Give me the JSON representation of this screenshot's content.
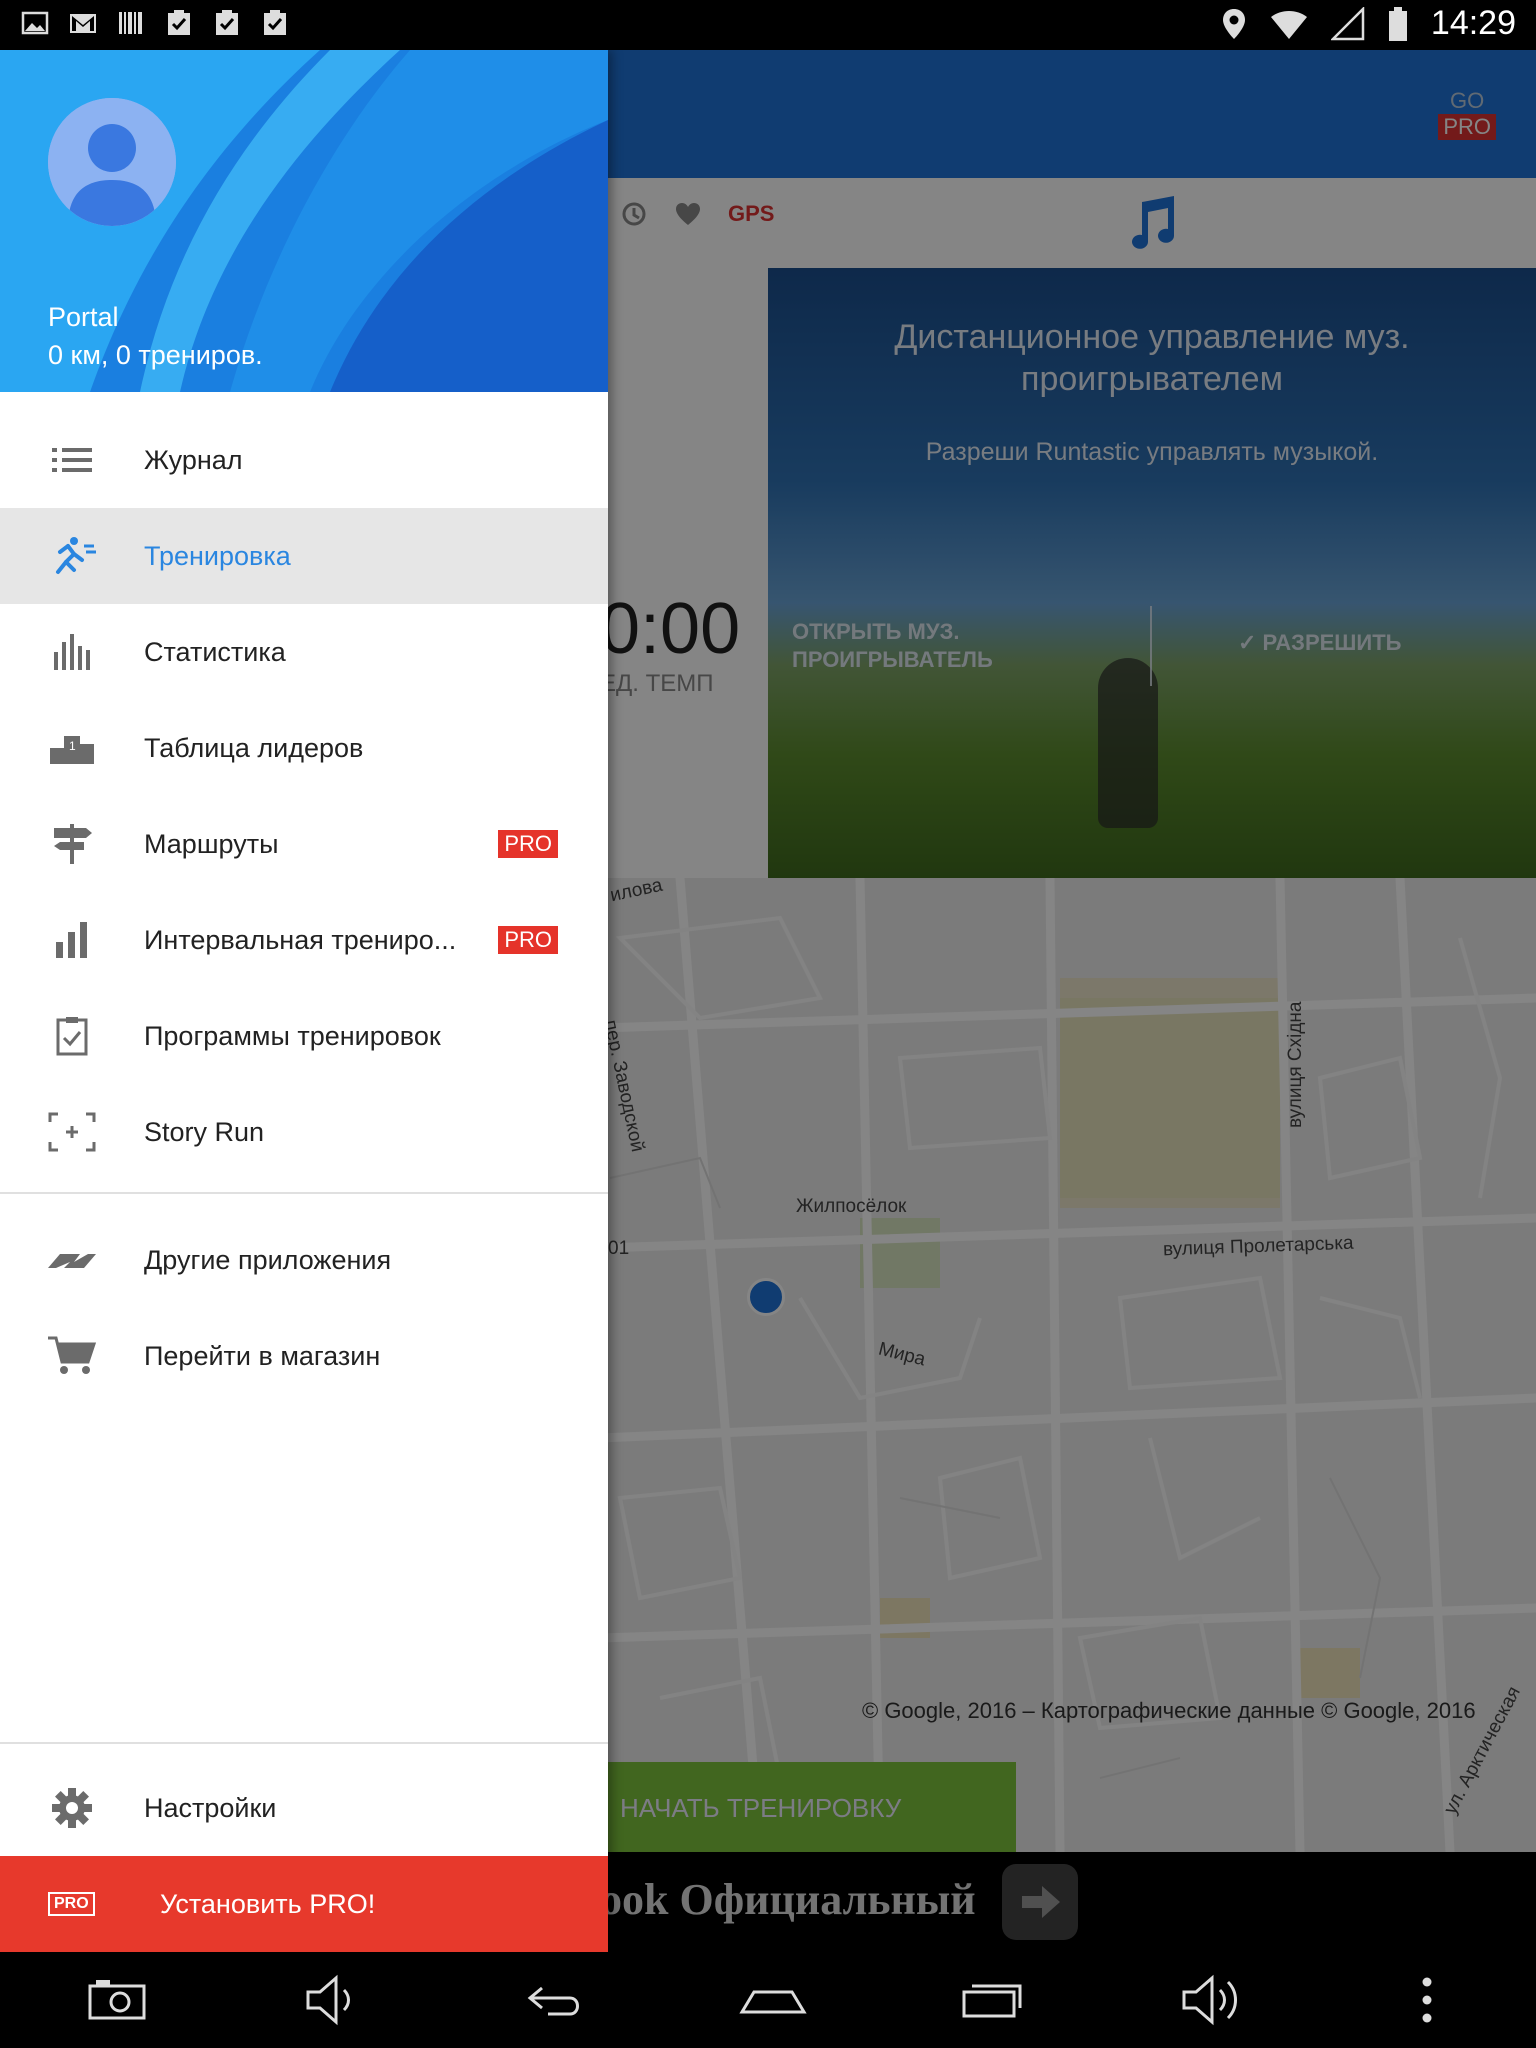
{
  "status_bar": {
    "time": "14:29",
    "notification_icons": [
      "image-icon",
      "gmail-icon",
      "barcode-icon",
      "clipboard-check-icon",
      "clipboard-check-icon",
      "clipboard-check-icon"
    ],
    "status_icons": [
      "location-icon",
      "wifi-icon",
      "signal-icon",
      "battery-icon"
    ]
  },
  "drawer": {
    "profile": {
      "name": "Portal",
      "stats": "0 км, 0 трениров."
    },
    "items": [
      {
        "label": "Журнал",
        "icon": "list-icon",
        "active": false,
        "pro": false
      },
      {
        "label": "Тренировка",
        "icon": "runner-icon",
        "active": true,
        "pro": false
      },
      {
        "label": "Статистика",
        "icon": "bar-chart-icon",
        "active": false,
        "pro": false
      },
      {
        "label": "Таблица лидеров",
        "icon": "podium-icon",
        "active": false,
        "pro": false
      },
      {
        "label": "Маршруты",
        "icon": "signpost-icon",
        "active": false,
        "pro": true
      },
      {
        "label": "Интервальная трениро...",
        "icon": "interval-bars-icon",
        "active": false,
        "pro": true
      },
      {
        "label": "Программы тренировок",
        "icon": "clipboard-check-icon",
        "active": false,
        "pro": false
      },
      {
        "label": "Story Run",
        "icon": "focus-frame-icon",
        "active": false,
        "pro": false
      }
    ],
    "secondary_items": [
      {
        "label": "Другие приложения",
        "icon": "runtastic-logo-icon"
      },
      {
        "label": "Перейти в магазин",
        "icon": "cart-icon"
      }
    ],
    "settings_label": "Настройки",
    "pro_badge": "PRO",
    "install_pro": {
      "badge": "PRO",
      "label": "Установить PRO!"
    }
  },
  "background": {
    "gopro": {
      "go": "GO",
      "pro": "PRO"
    },
    "gps_label": "GPS",
    "timer": {
      "value": "0:00",
      "caption": "ЕД. ТЕМП"
    },
    "music_card": {
      "title": "Дистанционное управление муз. проигрывателем",
      "subtitle": "Разреши Runtastic управлять музыкой.",
      "open_button": "ОТКРЫТЬ МУЗ. ПРОИГРЫВАТЕЛЬ",
      "allow_button": "РАЗРЕШИТЬ"
    },
    "map": {
      "labels": {
        "ilova": "илова",
        "zavodskoy": "пер. Заводской",
        "zhilposelok": "Жилпосёлок",
        "skhidna": "вулиця Східна",
        "proletarska": "вулиця Пролетарська",
        "mira": "Мира",
        "arkticheskaya": "ул. Арктическая",
        "num01": "01"
      },
      "copyright": "© Google, 2016 – Картографические данные © Google, 2016"
    },
    "start_button": "НАЧАТЬ ТРЕНИРОВКУ",
    "ad_text": "ook Официальный"
  },
  "nav_bar": {
    "buttons": [
      "screenshot-icon",
      "volume-down-icon",
      "back-icon",
      "home-icon",
      "recents-icon",
      "volume-up-icon",
      "more-icon"
    ]
  },
  "colors": {
    "accent_blue": "#2a86e0",
    "pro_red": "#e5332a",
    "start_green": "#7ec43c",
    "app_bar_blue": "#1f73d9"
  }
}
